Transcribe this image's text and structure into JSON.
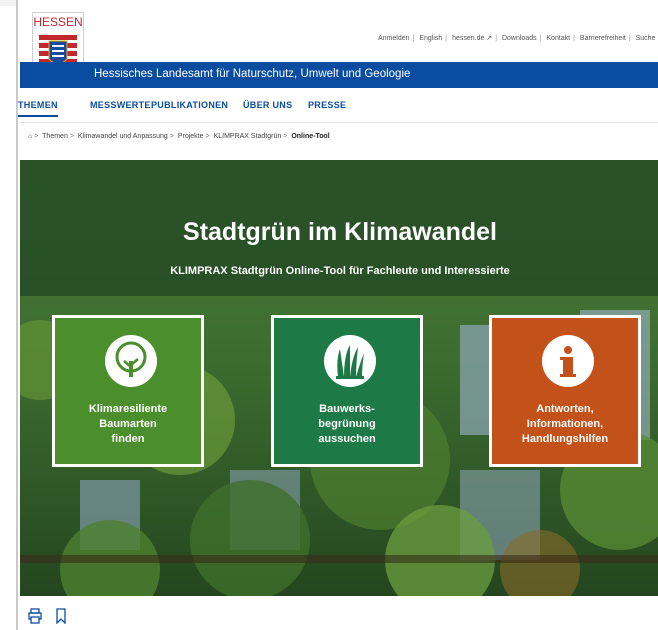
{
  "header": {
    "logo_text": "HESSEN",
    "top_links": [
      "Anmelden",
      "English",
      "hessen.de ↗",
      "Downloads",
      "Kontakt",
      "Barrierefreiheit",
      "Suche"
    ],
    "agency_title": "Hessisches Landesamt für Naturschutz, Umwelt und Geologie"
  },
  "main_nav": {
    "items": [
      "THEMEN",
      "MESSWERTE",
      "PUBLIKATIONEN",
      "ÜBER UNS",
      "PRESSE"
    ],
    "active": "THEMEN"
  },
  "breadcrumb": {
    "items": [
      "Themen",
      "Klimawandel und Anpassung",
      "Projekte",
      "KLIMPRAX Stadtgrün"
    ],
    "current": "Online-Tool"
  },
  "hero": {
    "title": "Stadtgrün im Klimawandel",
    "subtitle": "KLIMPRAX Stadtgrün Online-Tool für Fachleute und Interessierte"
  },
  "tiles": [
    {
      "label_lines": [
        "Klimaresiliente",
        "Baumarten",
        "finden"
      ],
      "icon": "tree-icon",
      "color": "#4b8e2c"
    },
    {
      "label_lines": [
        "Bauwerks-",
        "begrünung",
        "aussuchen"
      ],
      "icon": "grass-icon",
      "color": "#1d7a46"
    },
    {
      "label_lines": [
        "Antworten,",
        "Informationen,",
        "Handlungshilfen"
      ],
      "icon": "info-icon",
      "color": "#c3521a"
    }
  ],
  "colors": {
    "brand_blue": "#0a4da0",
    "hessen_red": "#c3282d"
  },
  "footer_tools": [
    "print-icon",
    "bookmark-icon"
  ]
}
